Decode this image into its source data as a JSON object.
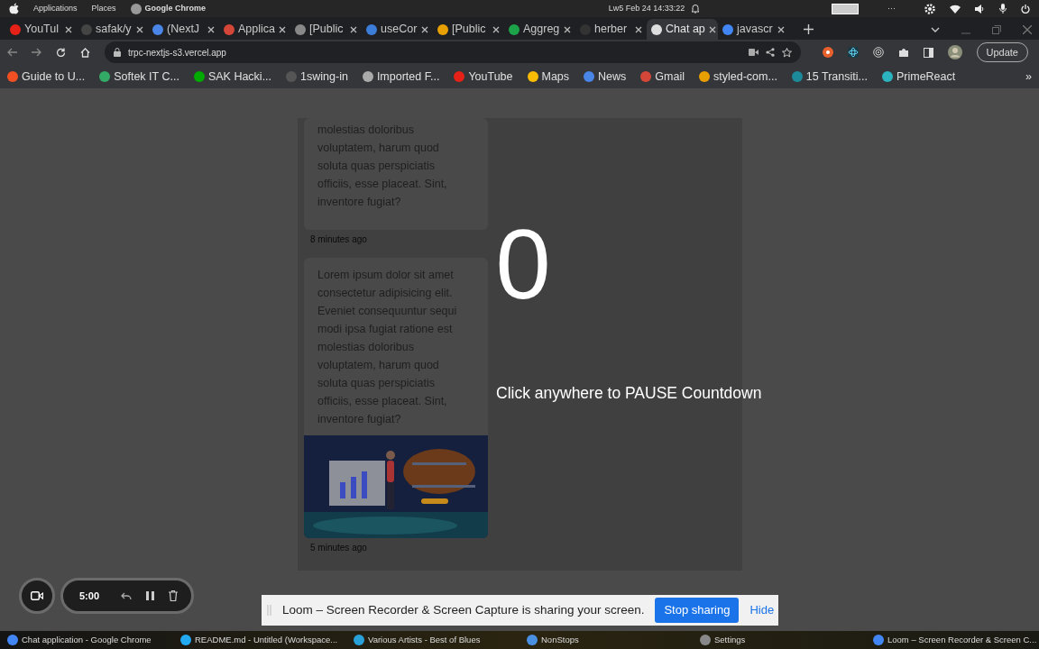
{
  "top_bar": {
    "menus": [
      "Applications",
      "Places"
    ],
    "app": "Google Chrome",
    "clock": "Lw5 Feb 24  14:33:22",
    "overflow": "···"
  },
  "tabs": [
    {
      "title": "YouTul",
      "selected": false
    },
    {
      "title": "safak/y",
      "selected": false
    },
    {
      "title": "(NextJ",
      "selected": false
    },
    {
      "title": "Applica",
      "selected": false
    },
    {
      "title": "[Public",
      "selected": false
    },
    {
      "title": "useCor",
      "selected": false
    },
    {
      "title": "[Public",
      "selected": false
    },
    {
      "title": "Aggreg",
      "selected": false
    },
    {
      "title": "herber",
      "selected": false
    },
    {
      "title": "Chat ap",
      "selected": true
    },
    {
      "title": "javascr",
      "selected": false
    }
  ],
  "toolbar": {
    "url": "trpc-nextjs-s3.vercel.app",
    "update_button": "Update"
  },
  "bookmarks": [
    "Guide to U...",
    "Softek IT C...",
    "SAK Hacki...",
    "1swing-in",
    "Imported F...",
    "YouTube",
    "Maps",
    "News",
    "Gmail",
    "styled-com...",
    "15 Transiti...",
    "PrimeReact"
  ],
  "bookmarks_more": "»",
  "messages": [
    {
      "text": "molestias doloribus voluptatem, harum quod soluta quas perspiciatis officiis, esse placeat. Sint, inventore fugiat?",
      "time": "8 minutes ago"
    },
    {
      "text": "Lorem ipsum dolor sit amet consectetur adipisicing elit. Eveniet consequuntur sequi modi ipsa fugiat ratione est molestias doloribus voluptatem, harum quod soluta quas perspiciatis officiis, esse placeat. Sint, inventore fugiat?",
      "time": "5 minutes ago"
    }
  ],
  "countdown": {
    "number": "0",
    "hint": "Click anywhere to PAUSE Countdown"
  },
  "recorder": {
    "timer": "5:00"
  },
  "share_bar": {
    "message": "Loom – Screen Recorder & Screen Capture is sharing your screen.",
    "stop_button": "Stop sharing",
    "hide_link": "Hide"
  },
  "taskbar": [
    "Chat application - Google Chrome",
    "README.md - Untitled (Workspace...",
    "Various Artists - Best of Blues",
    "NonStops",
    "Settings",
    "Loom – Screen Recorder & Screen C..."
  ]
}
